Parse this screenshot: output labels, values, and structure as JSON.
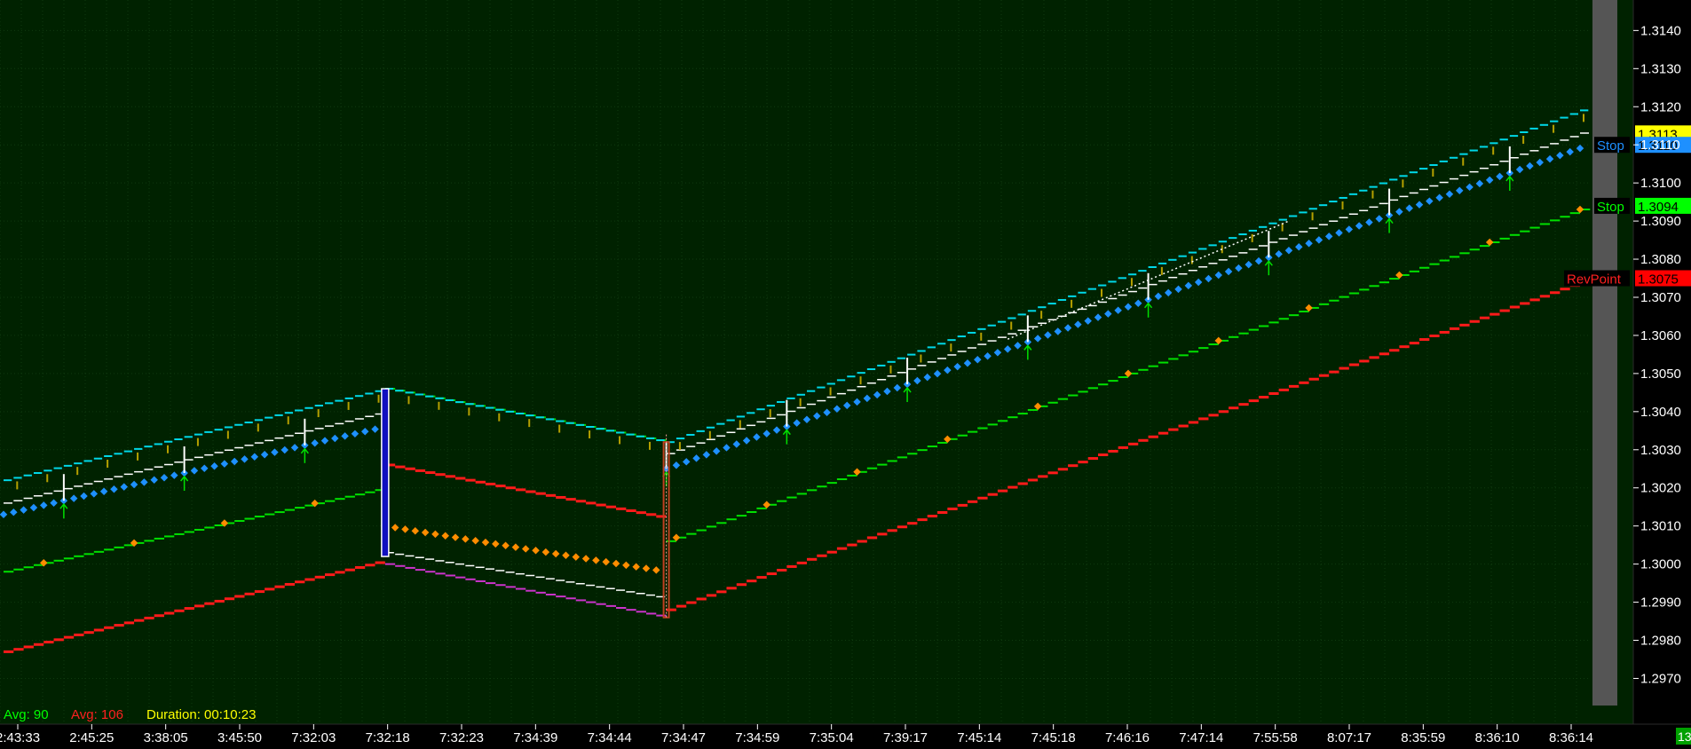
{
  "chart_data": {
    "type": "line",
    "title": "",
    "xlabel": "",
    "ylabel": "",
    "ylim": [
      1.2958,
      1.3148
    ],
    "y_ticks": [
      "1.3140",
      "1.3130",
      "1.3120",
      "1.3110",
      "1.3100",
      "1.3090",
      "1.3080",
      "1.3070",
      "1.3060",
      "1.3050",
      "1.3040",
      "1.3030",
      "1.3020",
      "1.3010",
      "1.3000",
      "1.2990",
      "1.2980",
      "1.2970"
    ],
    "x_tick_labels": [
      "2:43:33",
      "2:45:25",
      "3:38:05",
      "3:45:50",
      "7:32:03",
      "7:32:18",
      "7:32:23",
      "7:34:39",
      "7:34:44",
      "7:34:47",
      "7:34:59",
      "7:35:04",
      "7:39:17",
      "7:45:14",
      "7:45:18",
      "7:46:16",
      "7:47:14",
      "7:55:58",
      "8:07:17",
      "8:35:59",
      "8:36:10",
      "8:36:14"
    ],
    "bar_count": 158,
    "segments": [
      {
        "start": 0,
        "end": 38,
        "dir": "up",
        "top": [
          1.3022,
          1.3046
        ],
        "stop": [
          1.3013,
          1.3036
        ],
        "mid": [
          1.3016,
          1.304
        ],
        "green": [
          1.2998,
          1.302
        ],
        "red": [
          1.2977,
          1.3001
        ]
      },
      {
        "start": 38,
        "end": 66,
        "dir": "down",
        "top": [
          1.3046,
          1.3032
        ],
        "orange": [
          1.301,
          1.2998
        ],
        "purple": [
          1.3,
          1.2986
        ],
        "mid": [
          1.3003,
          1.2991
        ],
        "green": [
          1.3046,
          1.3032
        ],
        "red": [
          1.3026,
          1.3012
        ]
      },
      {
        "start": 66,
        "end": 158,
        "dir": "up",
        "top": [
          1.3032,
          1.312
        ],
        "stop": [
          1.3025,
          1.311
        ],
        "mid": [
          1.3029,
          1.3114
        ],
        "green": [
          1.3006,
          1.3094
        ],
        "red": [
          1.2988,
          1.3075
        ]
      }
    ],
    "price_tags": [
      {
        "label": "1.3113",
        "value": 1.3113,
        "bg": "#ffff00",
        "fg": "#000000"
      },
      {
        "label": "1.3110",
        "value": 1.311,
        "bg": "#1e90ff",
        "fg": "#000000"
      },
      {
        "label": "1.3094",
        "value": 1.3094,
        "bg": "#00ff00",
        "fg": "#000000"
      },
      {
        "label": "1.3075",
        "value": 1.3075,
        "bg": "#ff0000",
        "fg": "#000000"
      }
    ],
    "line_labels": [
      {
        "text": "Stop",
        "value": 1.311,
        "color": "#1e90ff"
      },
      {
        "text": "Stop",
        "value": 1.3094,
        "color": "#00ff00"
      },
      {
        "text": "RevPoint",
        "value": 1.3075,
        "color": "#ff2020"
      }
    ],
    "colors": {
      "background": "#002200",
      "grid": "#0f3a0f",
      "cyan_top": "#00d8e8",
      "stop_blue": "#1e90ff",
      "green_line": "#00e000",
      "red_line": "#ff1a1a",
      "orange_dots": "#ff8c00",
      "purple": "#cc33cc",
      "white_mid": "#ffffff",
      "olive_bars": "#b5a000",
      "axis_text": "#ffffff",
      "scroll_bar": "#555555"
    }
  },
  "status": {
    "avg_green": "Avg: 90",
    "avg_red": "Avg: 106",
    "duration": "Duration: 00:10:23",
    "corner_value": "13"
  }
}
